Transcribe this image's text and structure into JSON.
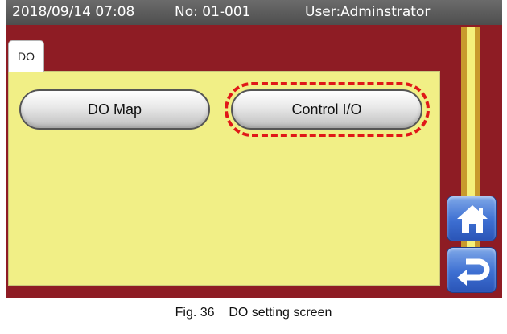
{
  "statusbar": {
    "datetime": "2018/09/14 07:08",
    "number": "No: 01-001",
    "user": "User:Adminstrator"
  },
  "tabs": [
    {
      "label": "DO",
      "active": true
    }
  ],
  "buttons": {
    "do_map": "DO Map",
    "control_io": "Control I/O"
  },
  "nav": {
    "home_icon": "home-icon",
    "back_icon": "return-arrow-icon"
  },
  "caption": "Fig. 36    DO setting screen",
  "colors": {
    "frame": "#8e1c24",
    "panel": "#f1ef86",
    "highlight": "#e01818",
    "nav_button": "#3d6fd2"
  }
}
